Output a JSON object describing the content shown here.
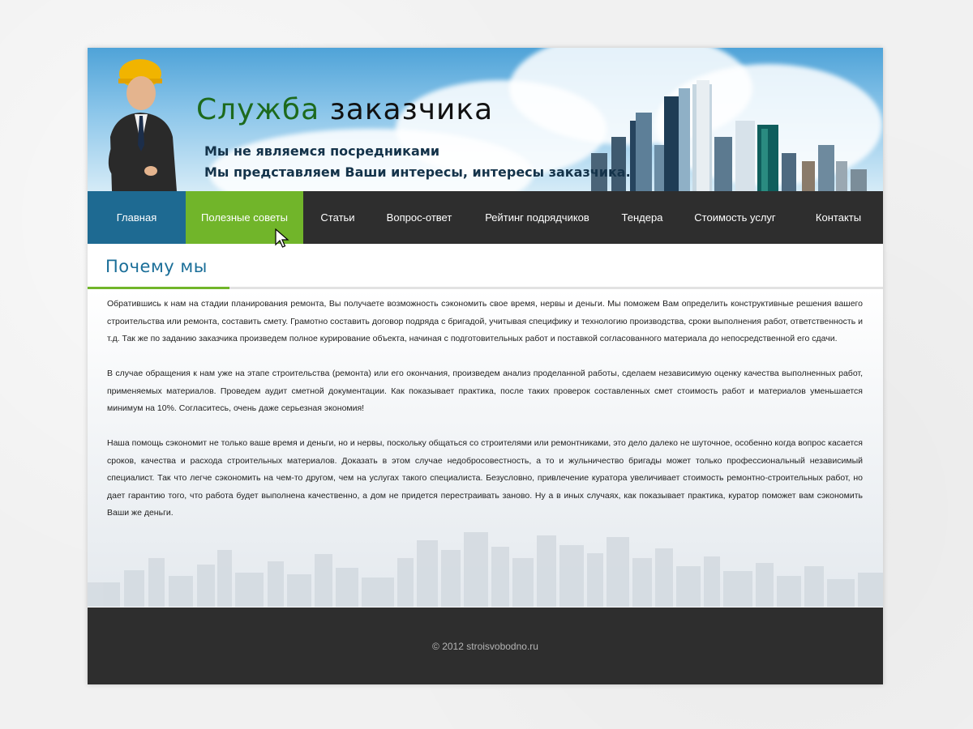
{
  "header": {
    "title_part1": "Служба",
    "title_part2": "заказчика",
    "slogan_line1": "Мы не являемся посредниками",
    "slogan_line2": "Мы представляем Ваши интересы, интересы заказчика."
  },
  "nav": {
    "items": [
      {
        "label": "Главная"
      },
      {
        "label": "Полезные советы"
      },
      {
        "label": "Статьи"
      },
      {
        "label": "Вопрос-ответ"
      },
      {
        "label": "Рейтинг подрядчиков"
      },
      {
        "label": "Тендера"
      },
      {
        "label": "Стоимость услуг"
      },
      {
        "label": "Контакты"
      }
    ]
  },
  "main": {
    "section_title": "Почему мы",
    "paragraphs": [
      "Обратившись к нам на стадии планирования ремонта, Вы получаете возможность сэкономить свое время, нервы и деньги. Мы поможем Вам определить конструктивные решения вашего строительства или ремонта, составить смету. Грамотно составить договор подряда с бригадой, учитывая специфику и технологию производства, сроки выполнения работ, ответственность и т.д. Так же по заданию заказчика произведем полное курирование объекта, начиная с подготовительных работ и поставкой согласованного материала до непосредственной его сдачи.",
      "В случае обращения к нам уже на этапе строительства (ремонта) или его окончания, произведем анализ проделанной работы, сделаем независимую оценку качества выполненных работ, применяемых материалов. Проведем аудит сметной документации. Как показывает практика, после таких проверок составленных смет стоимость работ и материалов уменьшается минимум на 10%. Согласитесь, очень даже серьезная экономия!",
      "Наша помощь сэкономит не только ваше время и деньги, но и нервы, поскольку общаться со строителями или ремонтниками, это дело далеко не шуточное, особенно когда вопрос касается сроков, качества и расхода строительных материалов. Доказать в этом случае недобросовестность, а то и жульничество бригады может только профессиональный независимый специалист. Так что легче сэкономить на чем-то другом, чем на услугах такого специалиста. Безусловно, привлечение куратора увеличивает стоимость ремонтно-строительных работ, но дает гарантию того, что работа будет выполнена качественно, а дом не придется перестраивать заново. Ну а в иных случаях, как показывает практика, куратор поможет вам сэкономить Ваши же деньги."
    ]
  },
  "footer": {
    "copyright": "© 2012 stroisvobodno.ru"
  },
  "colors": {
    "nav_bg": "#2e2e2e",
    "nav_home": "#1e6a92",
    "nav_active": "#71b52a",
    "title_blue": "#1a6e98",
    "title_green": "#1d6a1d"
  }
}
